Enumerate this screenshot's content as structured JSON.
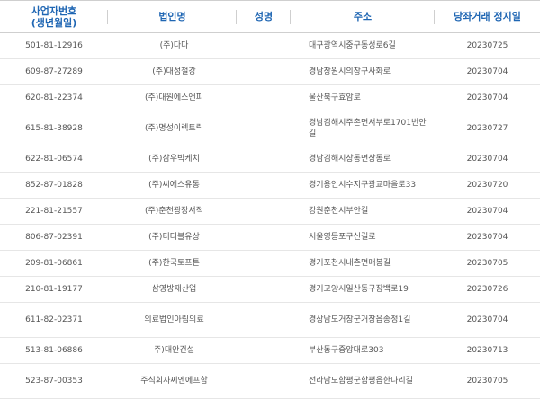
{
  "header": {
    "biz_no": "사업자번호",
    "birth": "(생년월일)",
    "corp_name": "법인명",
    "rep_name": "성명",
    "address": "주소",
    "stop_date": "당좌거래 정지일"
  },
  "rows": [
    {
      "biz_no": "501-81-12916",
      "corp_name": "(주)다다",
      "rep_name": "",
      "address_1": "대구광역시중구동성로6길",
      "address_2": "",
      "date": "20230725"
    },
    {
      "biz_no": "609-87-27289",
      "corp_name": "(주)대성철강",
      "rep_name": "",
      "address_1": "경남창원시의창구사화로",
      "address_2": "",
      "date": "20230704"
    },
    {
      "biz_no": "620-81-22374",
      "corp_name": "(주)대원에스앤피",
      "rep_name": "",
      "address_1": "울산북구효암로",
      "address_2": "",
      "date": "20230704"
    },
    {
      "biz_no": "615-81-38928",
      "corp_name": "(주)명성이렉트릭",
      "rep_name": "",
      "address_1": "경남김해시주촌면서부로1701번안",
      "address_2": "길",
      "date": "20230727"
    },
    {
      "biz_no": "622-81-06574",
      "corp_name": "(주)삼우빅케치",
      "rep_name": "",
      "address_1": "경남김해시상동면상동로",
      "address_2": "",
      "date": "20230704"
    },
    {
      "biz_no": "852-87-01828",
      "corp_name": "(주)씨에스유통",
      "rep_name": "",
      "address_1": "경기용인시수지구광교마을로33",
      "address_2": "",
      "date": "20230720"
    },
    {
      "biz_no": "221-81-21557",
      "corp_name": "(주)춘천광장서적",
      "rep_name": "",
      "address_1": "강원춘천시부안길",
      "address_2": "",
      "date": "20230704"
    },
    {
      "biz_no": "806-87-02391",
      "corp_name": "(주)티더블유상",
      "rep_name": "",
      "address_1": "서울영등포구신길로",
      "address_2": "",
      "date": "20230704"
    },
    {
      "biz_no": "209-81-06861",
      "corp_name": "(주)한국토프톤",
      "rep_name": "",
      "address_1": "경기포천시내촌면매봉길",
      "address_2": "",
      "date": "20230705"
    },
    {
      "biz_no": "210-81-19177",
      "corp_name": "삼영방재산업",
      "rep_name": "",
      "address_1": "경기고양시일산동구장백로19",
      "address_2": "",
      "date": "20230726"
    },
    {
      "biz_no": "611-82-02371",
      "corp_name": "의료법인아림의료",
      "rep_name": "",
      "address_1": "경상남도거창군거창읍송정1길",
      "address_2": "",
      "date": "20230704"
    },
    {
      "biz_no": "513-81-06886",
      "corp_name": "주)대안건설",
      "rep_name": "",
      "address_1": "부산동구중앙대로303",
      "address_2": "",
      "date": "20230713"
    },
    {
      "biz_no": "523-87-00353",
      "corp_name": "주식회사씨엔에프함",
      "rep_name": "",
      "address_1": "전라남도함평군함평읍한나리길",
      "address_2": "",
      "date": "20230705"
    }
  ]
}
